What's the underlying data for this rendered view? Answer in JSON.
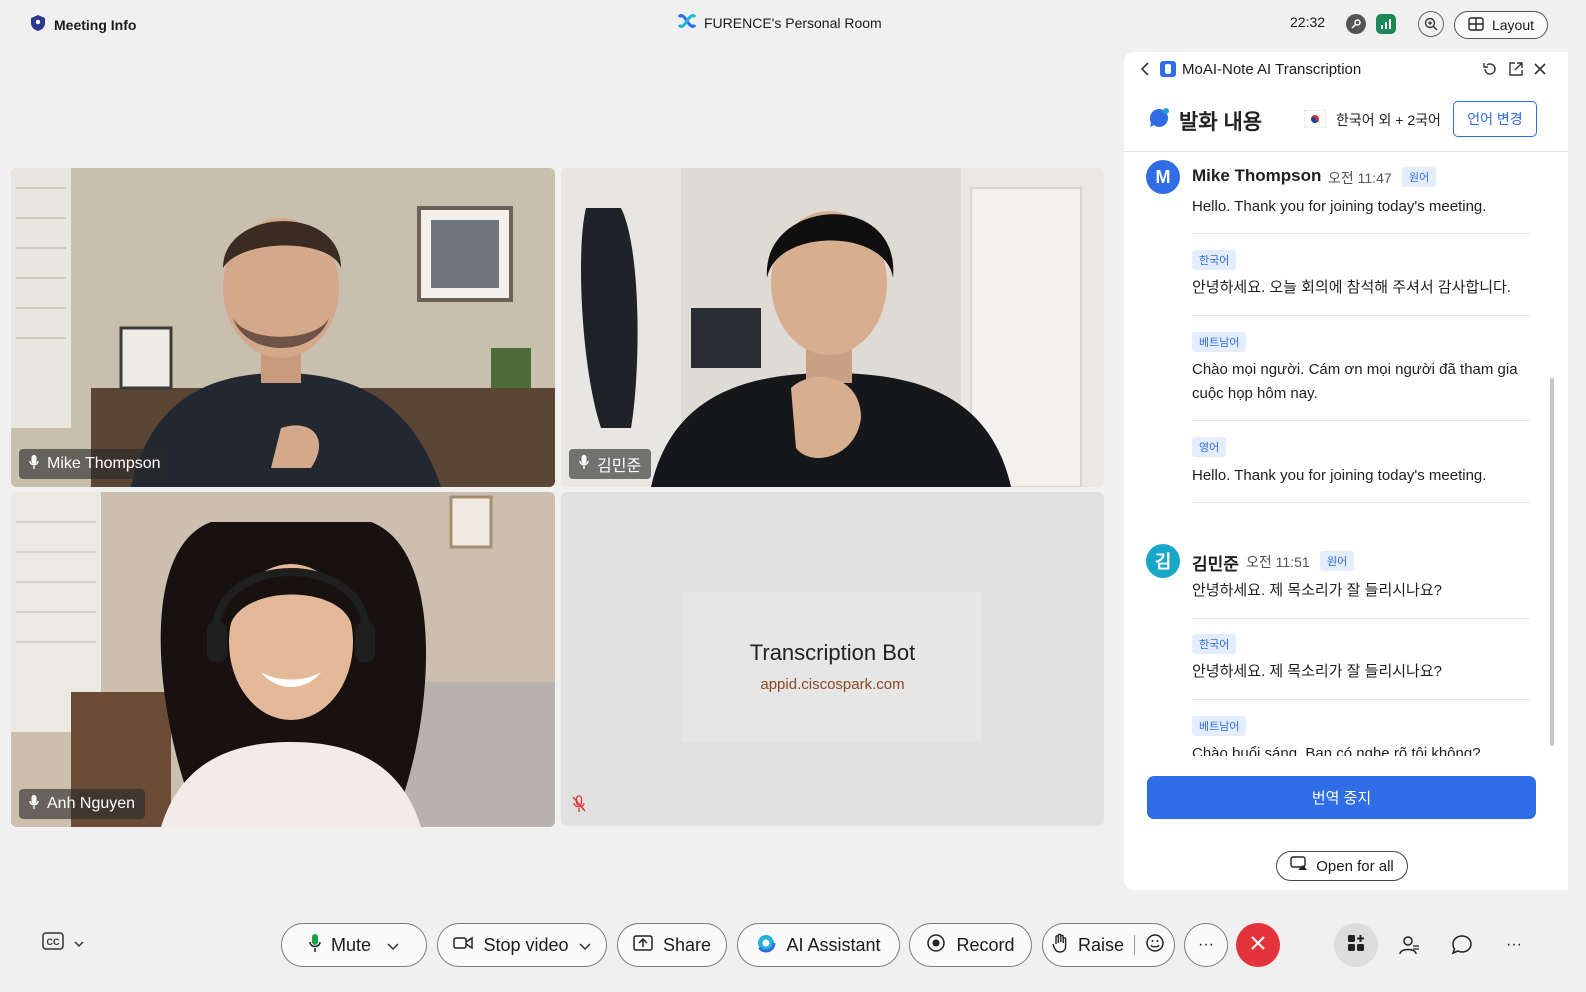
{
  "topbar": {
    "meeting_info": "Meeting Info",
    "room_title": "FURENCE's Personal Room",
    "clock": "22:32",
    "layout_label": "Layout"
  },
  "participants": {
    "p1": "Mike Thompson",
    "p2": "김민준",
    "p3": "Anh Nguyen",
    "bot_name": "Transcription Bot",
    "bot_url": "appid.ciscospark.com"
  },
  "panel": {
    "title": "MoAI-Note AI Transcription",
    "section_title": "발화 내용",
    "language_label": "한국어 외 + 2국어",
    "change_language": "언어 변경",
    "stop_translation": "번역 중지",
    "open_for_all": "Open for all"
  },
  "transcript": [
    {
      "avatar": "M",
      "avatar_color": "#2f6de6",
      "speaker": "Mike Thompson",
      "time": "오전 11:47",
      "badge": "원어",
      "text": "Hello. Thank you for joining today's meeting.",
      "translations": [
        {
          "lang": "한국어",
          "text": "안녕하세요. 오늘 회의에 참석해 주셔서 감사합니다."
        },
        {
          "lang": "베트남어",
          "text": "Chào mọi người. Cám ơn mọi người đã tham gia cuộc họp hôm nay."
        },
        {
          "lang": "영어",
          "text": "Hello. Thank you for joining today's meeting."
        }
      ]
    },
    {
      "avatar": "김",
      "avatar_color": "#17a7c9",
      "speaker": "김민준",
      "time": "오전 11:51",
      "badge": "원어",
      "text": "안녕하세요. 제 목소리가 잘 들리시나요?",
      "translations": [
        {
          "lang": "한국어",
          "text": "안녕하세요. 제 목소리가 잘 들리시나요?"
        },
        {
          "lang": "베트남어",
          "text": "Chào buổi sáng. Bạn có nghe rõ tôi không?"
        }
      ]
    }
  ],
  "toolbar": {
    "mute": "Mute",
    "stop_video": "Stop video",
    "share": "Share",
    "ai_assistant": "AI Assistant",
    "record": "Record",
    "raise": "Raise",
    "more": "···"
  },
  "colors": {
    "accent": "#2f6de6",
    "end_call": "#e5333b",
    "mic_active": "#1c9e4b"
  }
}
